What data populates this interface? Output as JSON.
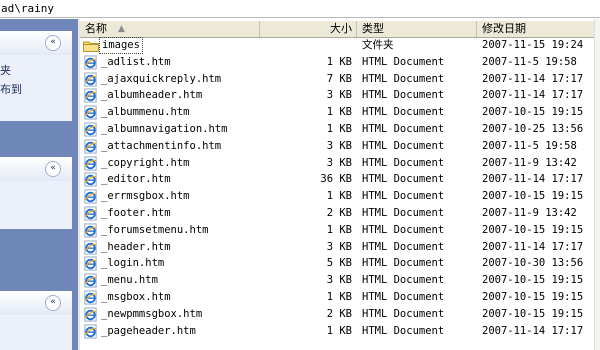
{
  "address": {
    "path": "ad\\rainy"
  },
  "tasks": {
    "panels": [
      {
        "chevron": "«",
        "lines": [
          "夹",
          "布到"
        ]
      },
      {
        "chevron": "«",
        "lines": []
      },
      {
        "chevron": "«",
        "lines": []
      }
    ]
  },
  "columns": {
    "name": "名称",
    "size": "大小",
    "type": "类型",
    "modified": "修改日期"
  },
  "files": [
    {
      "name": "images",
      "size": "",
      "type": "文件夹",
      "date": "2007-11-15 19:24",
      "icon": "folder-icon",
      "selected": true
    },
    {
      "name": "_adlist.htm",
      "size": "1 KB",
      "type": "HTML Document",
      "date": "2007-11-5 19:58",
      "icon": "ie-document-icon"
    },
    {
      "name": "_ajaxquickreply.htm",
      "size": "7 KB",
      "type": "HTML Document",
      "date": "2007-11-14 17:17",
      "icon": "ie-document-icon"
    },
    {
      "name": "_albumheader.htm",
      "size": "3 KB",
      "type": "HTML Document",
      "date": "2007-11-14 17:17",
      "icon": "ie-document-icon"
    },
    {
      "name": "_albummenu.htm",
      "size": "1 KB",
      "type": "HTML Document",
      "date": "2007-10-15 19:15",
      "icon": "ie-document-icon"
    },
    {
      "name": "_albumnavigation.htm",
      "size": "1 KB",
      "type": "HTML Document",
      "date": "2007-10-25 13:56",
      "icon": "ie-document-icon"
    },
    {
      "name": "_attachmentinfo.htm",
      "size": "3 KB",
      "type": "HTML Document",
      "date": "2007-11-5 19:58",
      "icon": "ie-document-icon"
    },
    {
      "name": "_copyright.htm",
      "size": "3 KB",
      "type": "HTML Document",
      "date": "2007-11-9 13:42",
      "icon": "ie-document-icon"
    },
    {
      "name": "_editor.htm",
      "size": "36 KB",
      "type": "HTML Document",
      "date": "2007-11-14 17:17",
      "icon": "ie-document-icon"
    },
    {
      "name": "_errmsgbox.htm",
      "size": "1 KB",
      "type": "HTML Document",
      "date": "2007-10-15 19:15",
      "icon": "ie-document-icon"
    },
    {
      "name": "_footer.htm",
      "size": "2 KB",
      "type": "HTML Document",
      "date": "2007-11-9 13:42",
      "icon": "ie-document-icon"
    },
    {
      "name": "_forumsetmenu.htm",
      "size": "1 KB",
      "type": "HTML Document",
      "date": "2007-10-15 19:15",
      "icon": "ie-document-icon"
    },
    {
      "name": "_header.htm",
      "size": "3 KB",
      "type": "HTML Document",
      "date": "2007-11-14 17:17",
      "icon": "ie-document-icon"
    },
    {
      "name": "_login.htm",
      "size": "5 KB",
      "type": "HTML Document",
      "date": "2007-10-30 13:56",
      "icon": "ie-document-icon"
    },
    {
      "name": "_menu.htm",
      "size": "3 KB",
      "type": "HTML Document",
      "date": "2007-10-15 19:15",
      "icon": "ie-document-icon"
    },
    {
      "name": "_msgbox.htm",
      "size": "1 KB",
      "type": "HTML Document",
      "date": "2007-10-15 19:15",
      "icon": "ie-document-icon"
    },
    {
      "name": "_newpmmsgbox.htm",
      "size": "2 KB",
      "type": "HTML Document",
      "date": "2007-10-15 19:15",
      "icon": "ie-document-icon"
    },
    {
      "name": "_pageheader.htm",
      "size": "1 KB",
      "type": "HTML Document",
      "date": "2007-11-14 17:17",
      "icon": "ie-document-icon"
    }
  ]
}
